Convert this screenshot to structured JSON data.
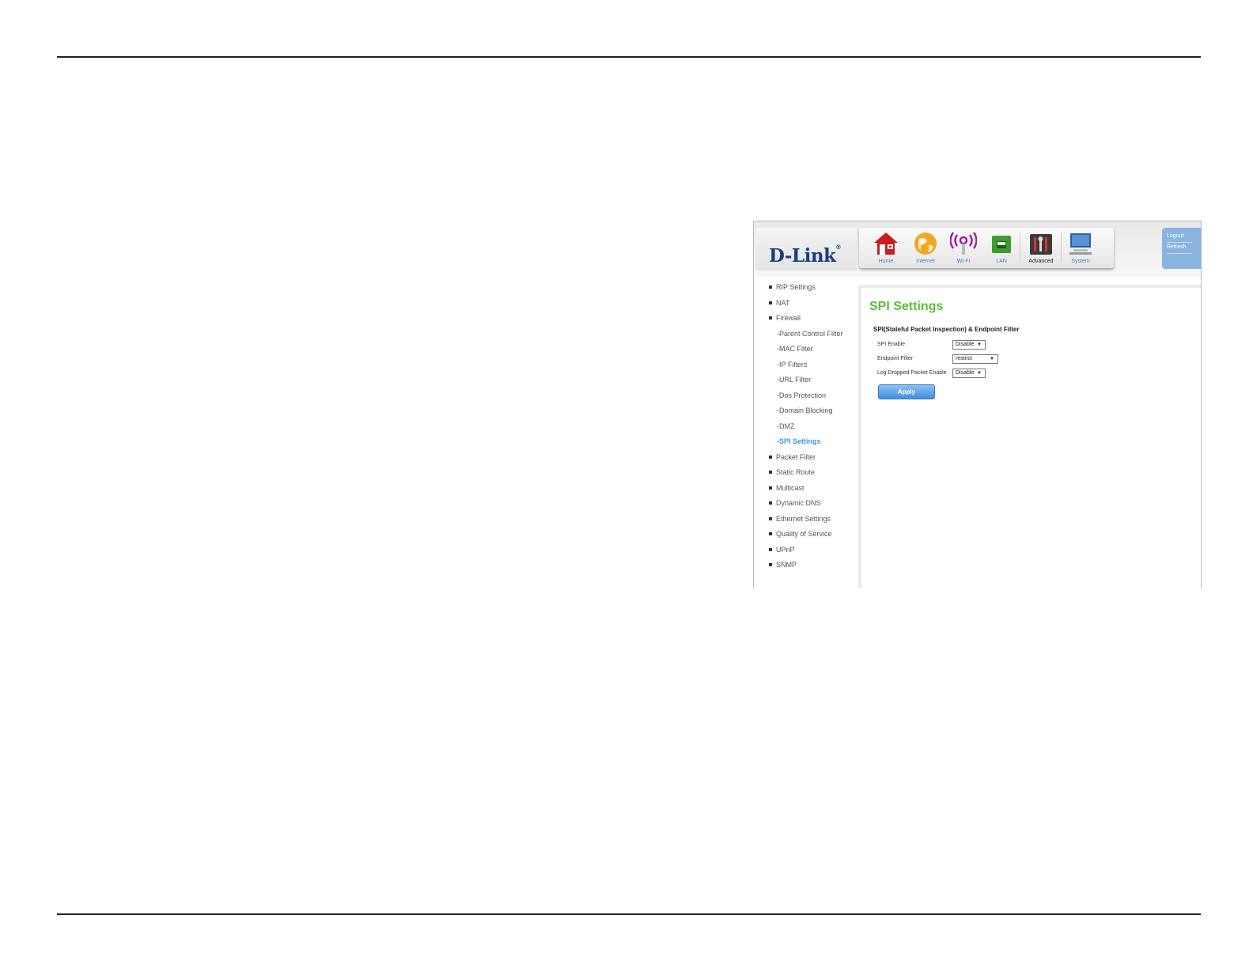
{
  "brand": {
    "logo_text": "D-Link",
    "logo_mark": "®"
  },
  "nav": {
    "home": "Home",
    "internet": "Internet",
    "wifi": "Wi-Fi",
    "lan": "LAN",
    "advanced": "Advanced",
    "system": "System"
  },
  "quick_links": {
    "logout": "Logout",
    "refresh": "Refresh"
  },
  "sidebar": {
    "rip": "RIP Settings",
    "nat": "NAT",
    "firewall": "Firewall",
    "parent_control": "-Parent Control Filter",
    "mac_filter": "-MAC Filter",
    "ip_filters": "-IP Filters",
    "url_filter": "-URL Filter",
    "dos": "-Dos Protection",
    "domain_blocking": "-Domain Blocking",
    "dmz": "-DMZ",
    "spi": "-SPI Settings",
    "packet_filter": "Packet Filter",
    "static_route": "Static Route",
    "multicast": "Multicast",
    "ddns": "Dynamic DNS",
    "ethernet": "Ethernet Settings",
    "qos": "Quality of Service",
    "upnp": "UPnP",
    "snmp": "SNMP"
  },
  "main": {
    "title": "SPI Settings",
    "section": "SPI(Stateful Packet Inspection) & Endpoint Filter",
    "fields": {
      "spi_enable_label": "SPI Enable",
      "spi_enable_value": "Disable",
      "endpoint_label": "Endpoint Filter",
      "endpoint_value": "restrict",
      "log_label": "Log Dropped Packet Enable",
      "log_value": "Disable"
    },
    "apply": "Apply"
  },
  "colors": {
    "title_green": "#5fbd3a",
    "active_link": "#3a9ad9",
    "brand_blue": "#1a3d82"
  }
}
